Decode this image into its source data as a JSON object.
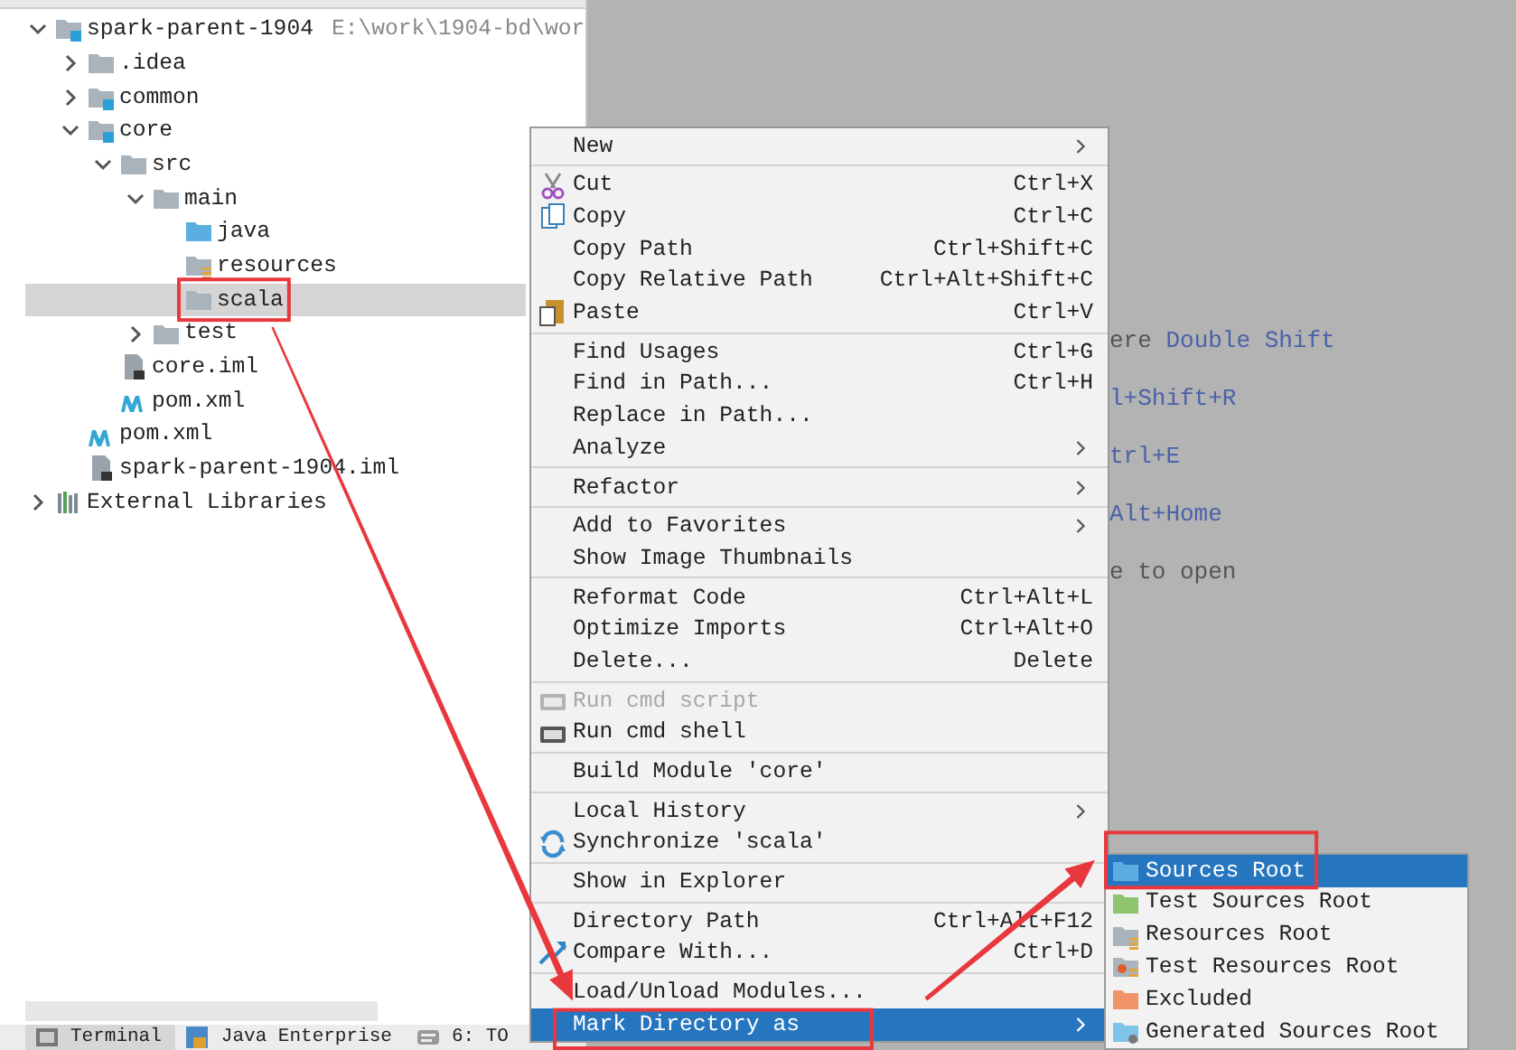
{
  "project_tree": {
    "items": [
      {
        "label": "spark-parent-1904",
        "path": "E:\\work\\1904-bd\\wor",
        "kind": "module",
        "expanded": true,
        "selected": false,
        "children": [
          {
            "label": ".idea",
            "kind": "folder",
            "expanded": false,
            "selected": false
          },
          {
            "label": "common",
            "kind": "module",
            "expanded": false,
            "selected": false
          },
          {
            "label": "core",
            "kind": "module",
            "expanded": true,
            "selected": false,
            "children": [
              {
                "label": "src",
                "kind": "folder",
                "expanded": true,
                "selected": false,
                "children": [
                  {
                    "label": "main",
                    "kind": "folder",
                    "expanded": true,
                    "selected": false,
                    "children": [
                      {
                        "label": "java",
                        "kind": "source",
                        "selected": false
                      },
                      {
                        "label": "resources",
                        "kind": "resources",
                        "selected": false
                      },
                      {
                        "label": "scala",
                        "kind": "folder",
                        "selected": true,
                        "annotated": true
                      }
                    ]
                  },
                  {
                    "label": "test",
                    "kind": "folder",
                    "expanded": false,
                    "selected": false
                  }
                ]
              },
              {
                "label": "core.iml",
                "kind": "iml",
                "selected": false
              },
              {
                "label": "pom.xml",
                "kind": "maven",
                "selected": false
              }
            ]
          },
          {
            "label": "pom.xml",
            "kind": "maven",
            "selected": false
          },
          {
            "label": "spark-parent-1904.iml",
            "kind": "iml",
            "selected": false
          }
        ]
      },
      {
        "label": "External Libraries",
        "kind": "libraries",
        "expanded": false,
        "selected": false
      }
    ]
  },
  "editor_hints": [
    {
      "segments": [
        {
          "text": "ere",
          "kind": "plain"
        },
        {
          "text": "Double Shift",
          "kind": "key"
        }
      ]
    },
    {
      "segments": [
        {
          "text": "l+Shift+R",
          "kind": "key"
        }
      ]
    },
    {
      "segments": [
        {
          "text": "trl+E",
          "kind": "key"
        }
      ]
    },
    {
      "segments": [
        {
          "text": "Alt+Home",
          "kind": "key"
        }
      ]
    },
    {
      "segments": [
        {
          "text": "e to open",
          "kind": "plain"
        }
      ]
    }
  ],
  "context_menu": {
    "groups": [
      [
        {
          "label": "New",
          "submenu": true
        }
      ],
      [
        {
          "label": "Cut",
          "shortcut": "Ctrl+X",
          "kind": "cut"
        },
        {
          "label": "Copy",
          "shortcut": "Ctrl+C",
          "kind": "copy"
        },
        {
          "label": "Copy Path",
          "shortcut": "Ctrl+Shift+C"
        },
        {
          "label": "Copy Relative Path",
          "shortcut": "Ctrl+Alt+Shift+C"
        },
        {
          "label": "Paste",
          "shortcut": "Ctrl+V",
          "kind": "paste"
        }
      ],
      [
        {
          "label": "Find Usages",
          "shortcut": "Ctrl+G"
        },
        {
          "label": "Find in Path...",
          "shortcut": "Ctrl+H"
        },
        {
          "label": "Replace in Path..."
        },
        {
          "label": "Analyze",
          "submenu": true
        }
      ],
      [
        {
          "label": "Refactor",
          "submenu": true
        }
      ],
      [
        {
          "label": "Add to Favorites",
          "submenu": true
        },
        {
          "label": "Show Image Thumbnails"
        }
      ],
      [
        {
          "label": "Reformat Code",
          "shortcut": "Ctrl+Alt+L"
        },
        {
          "label": "Optimize Imports",
          "shortcut": "Ctrl+Alt+O"
        },
        {
          "label": "Delete...",
          "shortcut": "Delete"
        }
      ],
      [
        {
          "label": "Run cmd script",
          "kind": "cmd",
          "disabled": true
        },
        {
          "label": "Run cmd shell",
          "kind": "cmd",
          "disabled": false
        }
      ],
      [
        {
          "label": "Build Module 'core'"
        }
      ],
      [
        {
          "label": "Local History",
          "submenu": true
        },
        {
          "label": "Synchronize 'scala'",
          "kind": "sync"
        }
      ],
      [
        {
          "label": "Show in Explorer"
        }
      ],
      [
        {
          "label": "Directory Path",
          "shortcut": "Ctrl+Alt+F12"
        },
        {
          "label": "Compare With...",
          "shortcut": "Ctrl+D",
          "kind": "compare"
        }
      ],
      [
        {
          "label": "Load/Unload Modules..."
        },
        {
          "label": "Mark Directory as",
          "submenu": true,
          "selected": true,
          "annotated": true
        }
      ]
    ]
  },
  "submenu": {
    "items": [
      {
        "label": "Sources Root",
        "kind": "source",
        "selected": true,
        "annotated": true
      },
      {
        "label": "Test Sources Root",
        "kind": "test",
        "selected": false
      },
      {
        "label": "Resources Root",
        "kind": "resources",
        "selected": false
      },
      {
        "label": "Test Resources Root",
        "kind": "test-resources",
        "selected": false
      },
      {
        "label": "Excluded",
        "kind": "excluded",
        "selected": false
      },
      {
        "label": "Generated Sources Root",
        "kind": "generated",
        "selected": false
      }
    ]
  },
  "bottom_tabs": [
    {
      "label": "Terminal",
      "kind": "terminal",
      "selected": true
    },
    {
      "label": "Java Enterprise",
      "kind": "java-ee",
      "selected": false
    },
    {
      "label": "6: TO",
      "kind": "todo",
      "selected": false
    }
  ]
}
